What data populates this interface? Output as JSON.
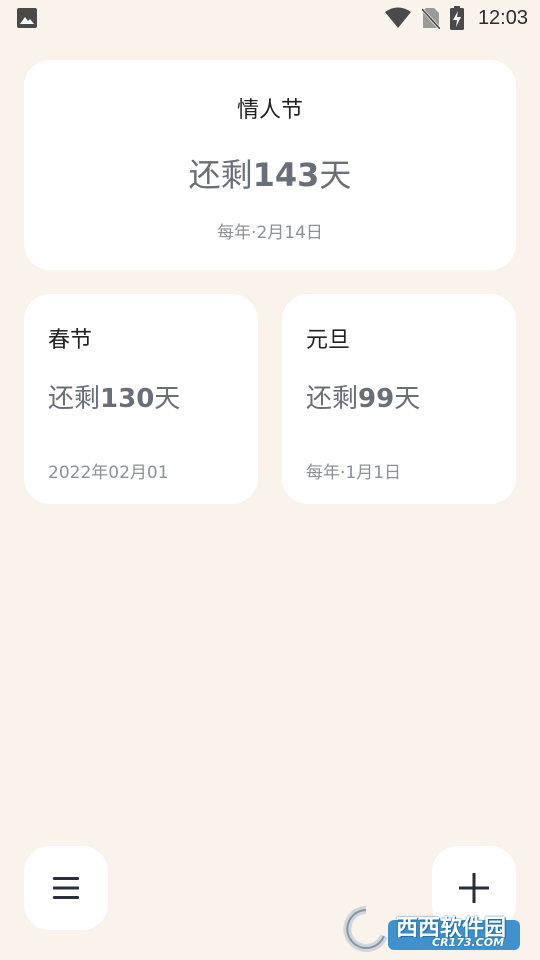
{
  "status_bar": {
    "time": "12:03",
    "icons": [
      "image-icon",
      "wifi-icon",
      "no-sim-icon",
      "battery-charging-icon"
    ]
  },
  "cards": {
    "featured": {
      "name": "情人节",
      "remaining_prefix": "还剩",
      "remaining_number": "143",
      "remaining_suffix": "天",
      "date": "每年·2月14日"
    },
    "left": {
      "name": "春节",
      "remaining_prefix": "还剩",
      "remaining_number": "130",
      "remaining_suffix": "天",
      "date": "2022年02月01"
    },
    "right": {
      "name": "元旦",
      "remaining_prefix": "还剩",
      "remaining_number": "99",
      "remaining_suffix": "天",
      "date": "每年·1月1日"
    }
  },
  "bottom_bar": {
    "menu_icon": "menu-icon",
    "add_icon": "plus-icon"
  },
  "watermark": {
    "text": "西西软件园",
    "sub": "CR173.COM"
  },
  "colors": {
    "background": "#faf3ec",
    "card": "#ffffff",
    "title_text": "#222222",
    "remaining_text": "#6a6e78",
    "date_text": "#8d9096"
  }
}
